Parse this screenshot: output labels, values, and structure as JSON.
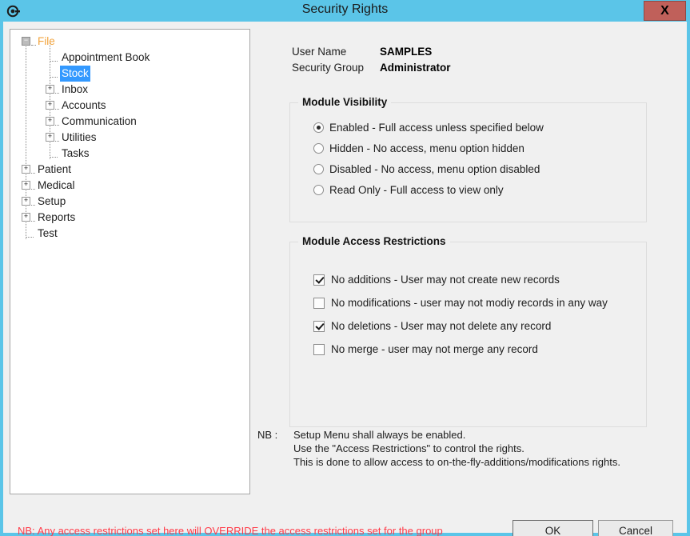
{
  "window": {
    "title": "Security Rights",
    "icon": "target-tool-icon",
    "close_label": "X",
    "titlebar_color": "#5bc5e8",
    "panel_color": "#f0f0f0",
    "close_button_color": "#c0605a"
  },
  "tree": {
    "selected": "Stock",
    "accent_color": "#f2a33c",
    "selection_color": "#3399ff",
    "nodes": [
      {
        "label": "File",
        "indent": 0,
        "expander": "minus",
        "state": "expanded"
      },
      {
        "label": "Appointment Book",
        "indent": 1,
        "expander": "none",
        "state": "leaf"
      },
      {
        "label": "Stock",
        "indent": 1,
        "expander": "none",
        "state": "leaf"
      },
      {
        "label": "Inbox",
        "indent": 1,
        "expander": "plus",
        "state": "collapsed"
      },
      {
        "label": "Accounts",
        "indent": 1,
        "expander": "plus",
        "state": "collapsed"
      },
      {
        "label": "Communication",
        "indent": 1,
        "expander": "plus",
        "state": "collapsed"
      },
      {
        "label": "Utilities",
        "indent": 1,
        "expander": "plus",
        "state": "collapsed"
      },
      {
        "label": "Tasks",
        "indent": 1,
        "expander": "none",
        "state": "leaf"
      },
      {
        "label": "Patient",
        "indent": 0,
        "expander": "plus",
        "state": "collapsed"
      },
      {
        "label": "Medical",
        "indent": 0,
        "expander": "plus",
        "state": "collapsed"
      },
      {
        "label": "Setup",
        "indent": 0,
        "expander": "plus",
        "state": "collapsed"
      },
      {
        "label": "Reports",
        "indent": 0,
        "expander": "plus",
        "state": "collapsed"
      },
      {
        "label": "Test",
        "indent": 0,
        "expander": "none",
        "state": "leaf"
      }
    ]
  },
  "user_info": {
    "user_name_label": "User Name",
    "user_name_value": "SAMPLES",
    "security_group_label": "Security Group",
    "security_group_value": "Administrator"
  },
  "module_visibility": {
    "title": "Module Visibility",
    "options": [
      {
        "label": "Enabled - Full access unless specified below",
        "selected": true
      },
      {
        "label": "Hidden - No access, menu option hidden",
        "selected": false
      },
      {
        "label": "Disabled - No access, menu option disabled",
        "selected": false
      },
      {
        "label": "Read Only - Full access to view only",
        "selected": false
      }
    ]
  },
  "module_access_restrictions": {
    "title": "Module Access Restrictions",
    "options": [
      {
        "label": "No additions - User may not create new records",
        "checked": true
      },
      {
        "label": "No modifications - user may not modiy records in any way",
        "checked": false
      },
      {
        "label": "No deletions - User may not delete any record",
        "checked": true
      },
      {
        "label": "No merge - user may not merge any record",
        "checked": false
      }
    ]
  },
  "note": {
    "key": "NB :",
    "line1": "Setup Menu shall always be enabled.",
    "line2": "Use the \"Access Restrictions\" to control the rights.",
    "line3": "This is done to allow access to on-the-fly-additions/modifications rights."
  },
  "footer": {
    "warning": "NB: Any access restrictions set here will OVERRIDE the access restrictions set for the group",
    "warning_color": "#ff3b48",
    "ok_label": "OK",
    "cancel_label": "Cancel"
  }
}
